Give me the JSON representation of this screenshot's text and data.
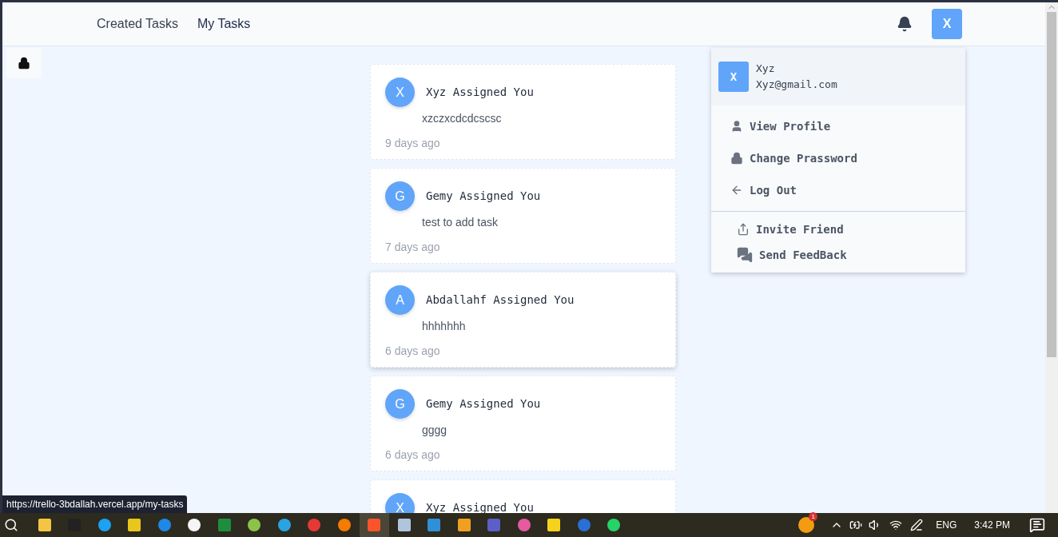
{
  "nav": {
    "links": [
      {
        "label": "Created Tasks",
        "selected": false
      },
      {
        "label": "My Tasks",
        "selected": true
      }
    ]
  },
  "user_button": {
    "initial": "X"
  },
  "dropdown": {
    "initial": "X",
    "name": "Xyz",
    "email": "Xyz@gmail.com",
    "items": [
      {
        "kind": "profile",
        "label": "View Profile"
      },
      {
        "kind": "password",
        "label": "Change Prassword"
      },
      {
        "kind": "logout",
        "label": "Log Out"
      }
    ],
    "extra_items": [
      {
        "kind": "invite",
        "label": "Invite Friend"
      },
      {
        "kind": "feedback",
        "label": "Send FeedBack"
      }
    ]
  },
  "tasks": [
    {
      "initial": "X",
      "title": "Xyz Assigned You",
      "description": "xzczxcdcdcscsc",
      "time": "9 days ago",
      "hovered": false
    },
    {
      "initial": "G",
      "title": "Gemy Assigned You",
      "description": "test to add task",
      "time": "7 days ago",
      "hovered": false
    },
    {
      "initial": "A",
      "title": "Abdallahf Assigned You",
      "description": "hhhhhhh",
      "time": "6 days ago",
      "hovered": true
    },
    {
      "initial": "G",
      "title": "Gemy Assigned You",
      "description": "gggg",
      "time": "6 days ago",
      "hovered": false
    },
    {
      "initial": "X",
      "title": "Xyz Assigned You",
      "hovered": false
    }
  ],
  "status_url": "https://trello-3bdallah.vercel.app/my-tasks",
  "taskbar": {
    "weather_badge": "1",
    "language": "ENG",
    "time": "3:42 PM"
  }
}
